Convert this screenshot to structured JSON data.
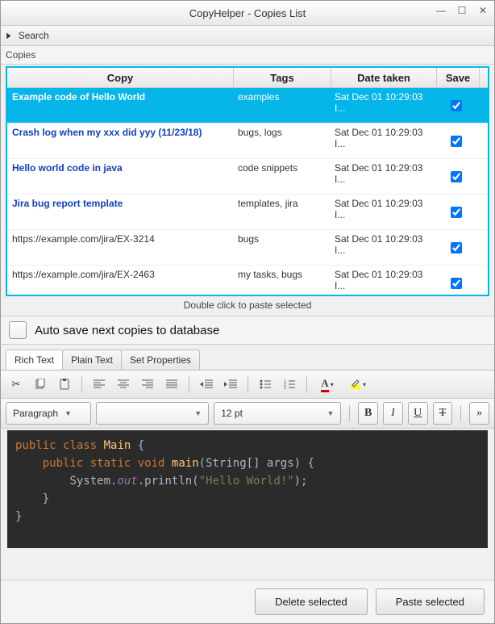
{
  "window": {
    "title": "CopyHelper - Copies List"
  },
  "search": {
    "label": "Search"
  },
  "section_label": "Copies",
  "columns": {
    "copy": "Copy",
    "tags": "Tags",
    "date": "Date taken",
    "save": "Save"
  },
  "rows": [
    {
      "copy": "Example code of Hello World",
      "tags": "examples",
      "date": "Sat Dec 01 10:29:03 I...",
      "saved": true,
      "selected": true,
      "is_url": false
    },
    {
      "copy": "Crash log when my xxx did yyy (11/23/18)",
      "tags": "bugs, logs",
      "date": "Sat Dec 01 10:29:03 I...",
      "saved": true,
      "selected": false,
      "is_url": false
    },
    {
      "copy": "Hello world code in java",
      "tags": "code snippets",
      "date": "Sat Dec 01 10:29:03 I...",
      "saved": true,
      "selected": false,
      "is_url": false
    },
    {
      "copy": "Jira bug report template",
      "tags": "templates, jira",
      "date": "Sat Dec 01 10:29:03 I...",
      "saved": true,
      "selected": false,
      "is_url": false
    },
    {
      "copy": "https://example.com/jira/EX-3214",
      "tags": "bugs",
      "date": "Sat Dec 01 10:29:03 I...",
      "saved": true,
      "selected": false,
      "is_url": true
    },
    {
      "copy": "https://example.com/jira/EX-2463",
      "tags": "my tasks, bugs",
      "date": "Sat Dec 01 10:29:03 I...",
      "saved": true,
      "selected": false,
      "is_url": true
    }
  ],
  "hint": "Double click to paste selected",
  "autosave": {
    "label": "Auto save next copies to database",
    "checked": false
  },
  "tabs": [
    {
      "id": "rich",
      "label": "Rich Text",
      "active": true
    },
    {
      "id": "plain",
      "label": "Plain Text",
      "active": false
    },
    {
      "id": "props",
      "label": "Set Properties",
      "active": false
    }
  ],
  "format": {
    "paragraph": "Paragraph",
    "font": "",
    "size": "12 pt"
  },
  "code": {
    "l1a": "public",
    "l1b": "class",
    "l1c": "Main",
    "l1d": "{",
    "l2a": "public",
    "l2b": "static",
    "l2c": "void",
    "l2d": "main",
    "l2e": "(String[] args) {",
    "l3a": "System.",
    "l3b": "out",
    "l3c": ".println(",
    "l3d": "\"Hello World!\"",
    "l3e": ");",
    "l4": "}",
    "l5": "}"
  },
  "buttons": {
    "delete": "Delete selected",
    "paste": "Paste selected"
  }
}
